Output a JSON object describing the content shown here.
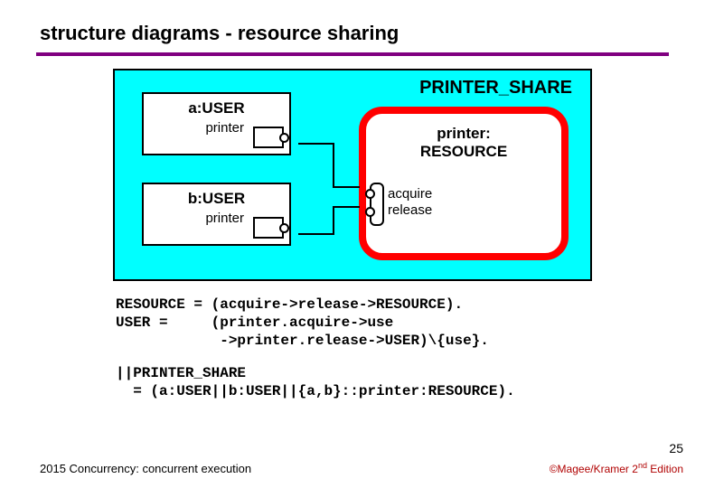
{
  "title": "structure diagrams - resource sharing",
  "diagram": {
    "outer_title": "PRINTER_SHARE",
    "user_a": {
      "label": "a:USER",
      "port": "printer"
    },
    "user_b": {
      "label": "b:USER",
      "port": "printer"
    },
    "resource": {
      "label1": "printer:",
      "label2": "RESOURCE",
      "port_acquire": "acquire",
      "port_release": "release"
    }
  },
  "code1": "RESOURCE = (acquire->release->RESOURCE).\nUSER =     (printer.acquire->use\n            ->printer.release->USER)\\{use}.",
  "code2": "||PRINTER_SHARE\n  = (a:USER||b:USER||{a,b}::printer:RESOURCE).",
  "slide_number": "25",
  "footer_left": "2015  Concurrency: concurrent execution",
  "footer_right_prefix": "©Magee/Kramer ",
  "footer_right_edition_num": "2",
  "footer_right_edition_suffix": "nd",
  "footer_right_tail": " Edition"
}
